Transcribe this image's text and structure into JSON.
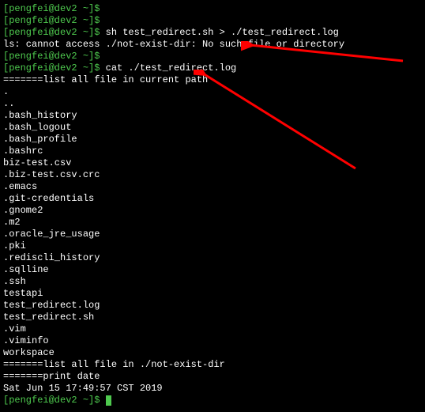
{
  "prompts": {
    "p0": "[pengfei@dev2 ~]$ ",
    "p1": "[pengfei@dev2 ~]$ ",
    "p2": "[pengfei@dev2 ~]$ ",
    "p3": "[pengfei@dev2 ~]$ ",
    "p4": "[pengfei@dev2 ~]$ ",
    "p5": "[pengfei@dev2 ~]$ "
  },
  "commands": {
    "c0": "sh test_redirect.sh > ./test_redirect.log",
    "c1": "cat ./test_redirect.log"
  },
  "output": {
    "err": "ls: cannot access ./not-exist-dir: No such file or directory",
    "section1": "=======list all file in current path",
    "files": [
      ".",
      "..",
      ".bash_history",
      ".bash_logout",
      ".bash_profile",
      ".bashrc",
      "biz-test.csv",
      ".biz-test.csv.crc",
      ".emacs",
      ".git-credentials",
      ".gnome2",
      ".m2",
      ".oracle_jre_usage",
      ".pki",
      ".rediscli_history",
      ".sqlline",
      ".ssh",
      "testapi",
      "test_redirect.log",
      "test_redirect.sh",
      ".vim",
      ".viminfo",
      "workspace"
    ],
    "section2": "=======list all file in ./not-exist-dir",
    "section3": "=======print date",
    "date": "Sat Jun 15 17:49:57 CST 2019"
  }
}
